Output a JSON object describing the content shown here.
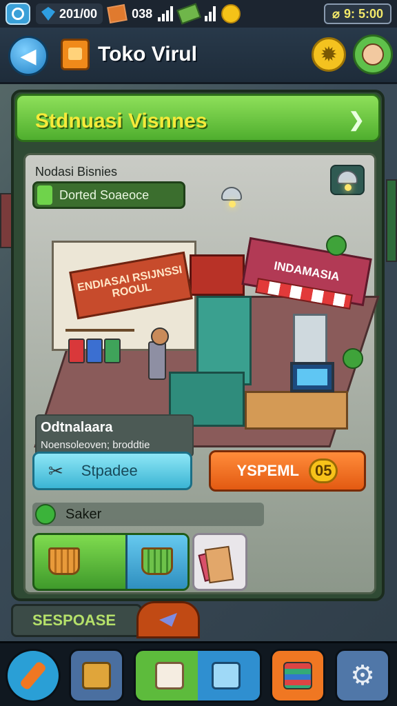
{
  "status_bar": {
    "gems": "201/00",
    "items": "038",
    "battery_time": "9: 5:00",
    "icons": [
      "app-icon",
      "gem-icon",
      "crate-icon",
      "signal-icon",
      "cash-icon",
      "sun-icon",
      "battery-icon"
    ]
  },
  "header": {
    "title": "Toko Virul",
    "icons": [
      "back-arrow-icon",
      "shop-icon",
      "gear-icon",
      "avatar-icon"
    ]
  },
  "panel": {
    "title": "Stdnuasi Visnnes",
    "card_label": "Nodasi Bisnies",
    "status_chip": "Dorted Soaeoce",
    "shop_sign_left": "ENDIASAI RSIJNSSI ROOUL",
    "shop_sign_right": "INDAMASIA",
    "info_title": "Odtnalaara",
    "info_subtitle": "Noensoleoven; broddtie",
    "cyan_button": "Stpadee",
    "orange_button": "YSPEML",
    "orange_badge": "05",
    "sub_label": "Saker",
    "tray_icons": [
      "basket-icon",
      "basket-selected-icon",
      "shopping-bags-icon"
    ]
  },
  "lower_bar": {
    "response_label": "SESPOASE",
    "tab_icon": "paper-plane-icon"
  },
  "bottom_nav": {
    "icons": [
      "edit-pencil-icon",
      "crate-icon",
      "store-box-icon",
      "cart-icon",
      "books-stack-icon",
      "settings-gear-icon"
    ],
    "colors": [
      "#2a9fd6",
      "#4a6fa0",
      "#5dbb3c",
      "#2f8fd0",
      "#f07722",
      "#5077a8"
    ]
  }
}
